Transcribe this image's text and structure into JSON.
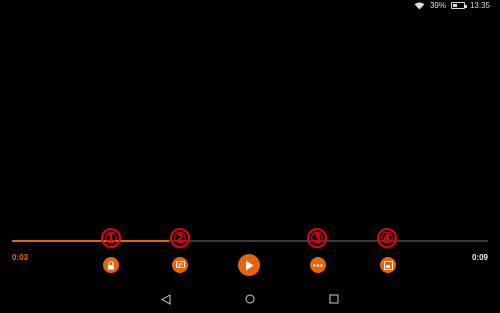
{
  "status_bar": {
    "battery": "39%",
    "battery_level": 0.39,
    "time": "13:35",
    "icons": [
      "wifi-icon",
      "battery-icon"
    ]
  },
  "player": {
    "elapsed": "0:03",
    "total": "0:09",
    "progress_fraction": 0.33,
    "accent_color": "#e8640c",
    "controls": [
      {
        "name": "lock-icon"
      },
      {
        "name": "subtitles-icon"
      },
      {
        "name": "play-icon"
      },
      {
        "name": "more-options-icon"
      },
      {
        "name": "aspect-ratio-icon"
      }
    ]
  },
  "annotations": {
    "labels": [
      "①",
      "②",
      "③",
      "④"
    ],
    "color": "#e60012"
  },
  "nav_bar": {
    "buttons": [
      "back-icon",
      "home-icon",
      "recents-icon"
    ]
  }
}
